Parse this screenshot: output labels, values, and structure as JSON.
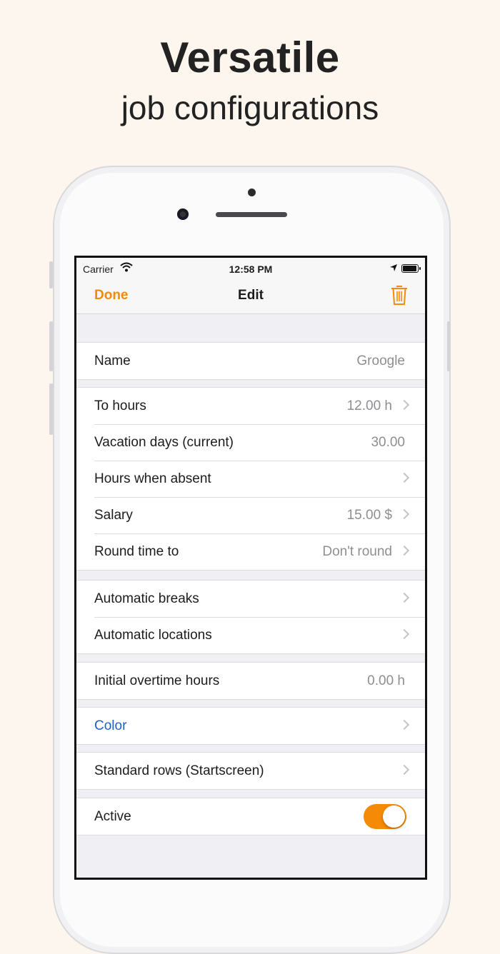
{
  "headline": {
    "line1": "Versatile",
    "line2": "job configurations"
  },
  "status_bar": {
    "carrier": "Carrier",
    "time": "12:58 PM",
    "icons": [
      "wifi-icon",
      "location-arrow-icon",
      "battery-icon"
    ]
  },
  "nav": {
    "left_button": "Done",
    "title": "Edit",
    "right_icon": "trash-icon"
  },
  "sections": {
    "name": {
      "label": "Name",
      "value": "Groogle"
    },
    "hours": [
      {
        "label": "To hours",
        "value": "12.00 h"
      },
      {
        "label": "Vacation days (current)",
        "value": "30.00"
      },
      {
        "label": "Hours when absent",
        "value": ""
      },
      {
        "label": "Salary",
        "value": "15.00 $"
      },
      {
        "label": "Round time to",
        "value": "Don't round"
      }
    ],
    "automatic": [
      {
        "label": "Automatic breaks"
      },
      {
        "label": "Automatic locations"
      }
    ],
    "overtime": {
      "label": "Initial overtime hours",
      "value": "0.00 h"
    },
    "color": {
      "label": "Color"
    },
    "standard_rows": {
      "label": "Standard rows (Startscreen)"
    },
    "active": {
      "label": "Active",
      "enabled": true
    }
  },
  "colors": {
    "accent": "#f58a07",
    "link": "#1f62c6",
    "background": "#fdf6ee",
    "grouped_background": "#efeff4"
  }
}
